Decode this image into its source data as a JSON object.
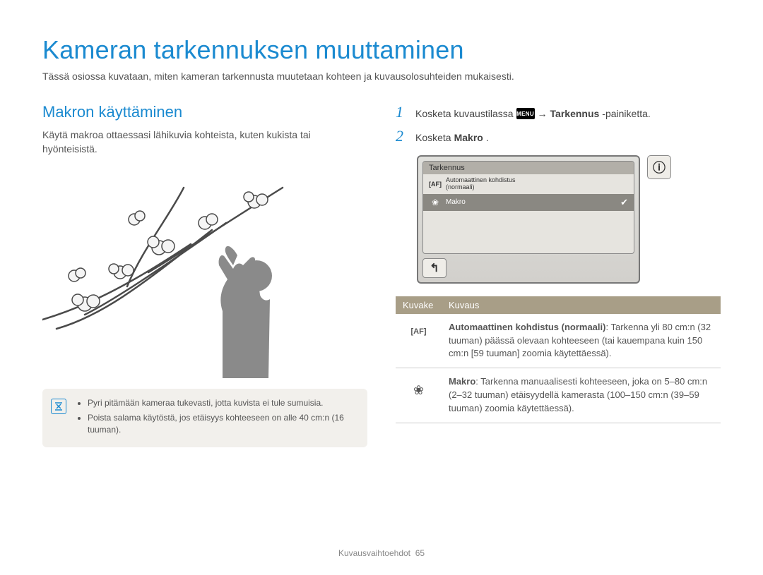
{
  "title": "Kameran tarkennuksen muuttaminen",
  "intro": "Tässä osiossa kuvataan, miten kameran tarkennusta muutetaan kohteen ja kuvausolosuhteiden mukaisesti.",
  "left": {
    "heading": "Makron käyttäminen",
    "body": "Käytä makroa ottaessasi lähikuvia kohteista, kuten kukista tai hyönteisistä.",
    "tips": [
      "Pyri pitämään kameraa tukevasti, jotta kuvista ei tule sumuisia.",
      "Poista salama käytöstä, jos etäisyys kohteeseen on alle 40 cm:n (16 tuuman)."
    ]
  },
  "right": {
    "steps": [
      {
        "num": "1",
        "prefix": "Kosketa kuvaustilassa ",
        "menu_chip": "MENU",
        "arrow": " → ",
        "bold": "Tarkennus",
        "suffix": "-painiketta."
      },
      {
        "num": "2",
        "prefix": "Kosketa ",
        "bold": "Makro",
        "suffix": "."
      }
    ],
    "lcd": {
      "title": "Tarkennus",
      "row_af_top": "Automaattinen kohdistus",
      "row_af_bottom": "(normaali)",
      "row_makro": "Makro",
      "back_glyph": "↰",
      "info_glyph": "ⓘ",
      "af_glyph": "[AF]",
      "flower_glyph": "❀",
      "check_glyph": "✔"
    },
    "table": {
      "h1": "Kuvake",
      "h2": "Kuvaus",
      "rows": [
        {
          "icon": "[AF]",
          "bold": "Automaattinen kohdistus (normaali)",
          "rest": ": Tarkenna yli 80 cm:n (32 tuuman) päässä olevaan kohteeseen (tai kauempana kuin 150 cm:n [59 tuuman] zoomia käytettäessä)."
        },
        {
          "icon": "❀",
          "bold": "Makro",
          "rest": ": Tarkenna manuaalisesti kohteeseen, joka on 5–80 cm:n (2–32 tuuman) etäisyydellä kamerasta (100–150 cm:n (39–59 tuuman) zoomia käytettäessä)."
        }
      ]
    }
  },
  "footer": {
    "section": "Kuvausvaihtoehdot",
    "page": "65"
  },
  "colors": {
    "accent": "#1b8ad0",
    "table_head": "#a89e87"
  }
}
